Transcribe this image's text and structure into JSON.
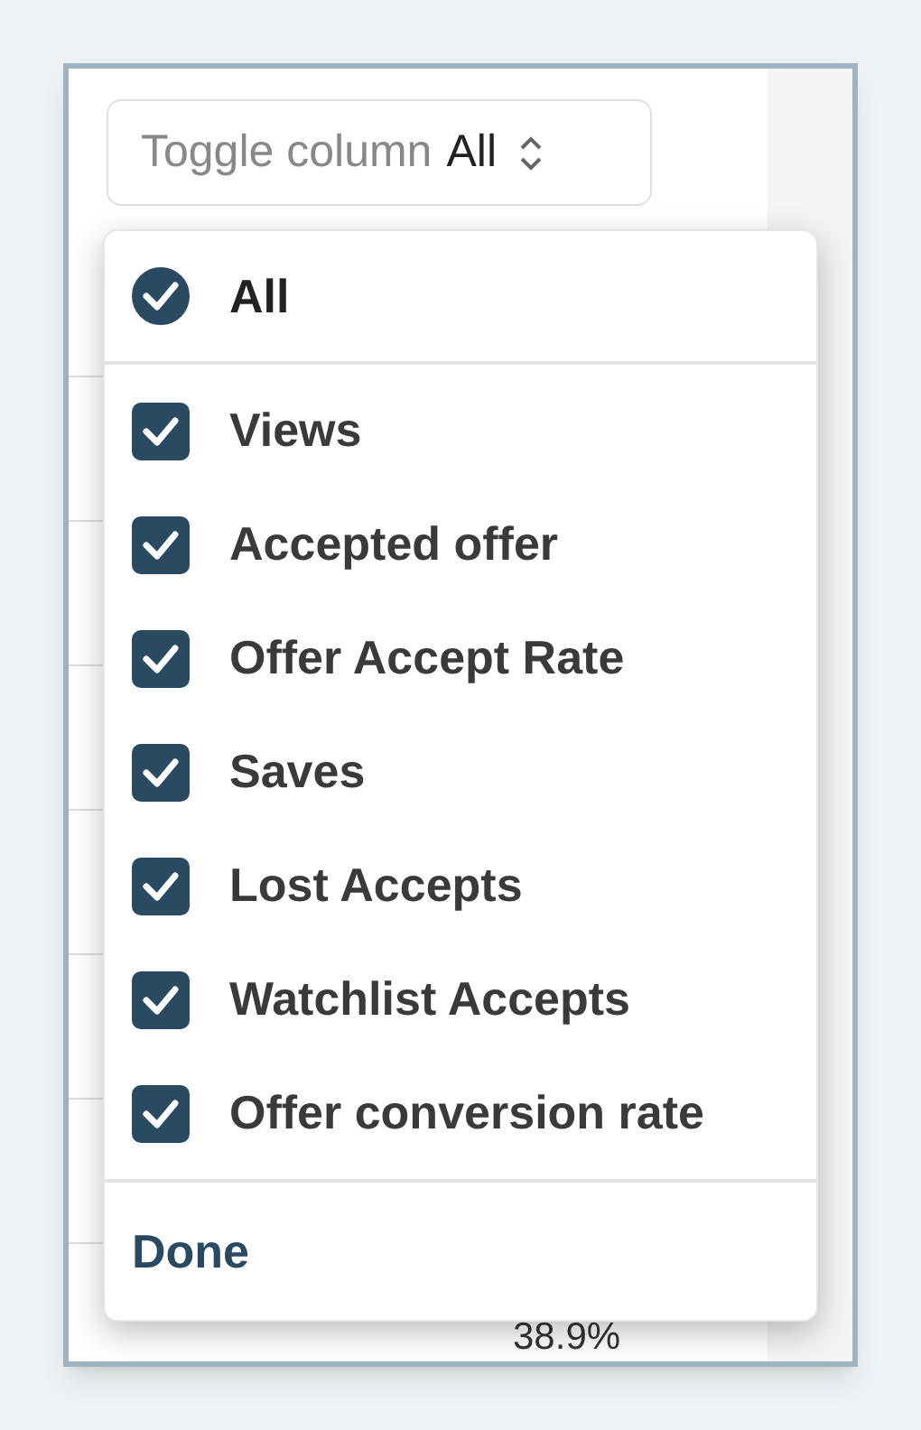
{
  "toggle": {
    "label": "Toggle column",
    "value": "All"
  },
  "menu": {
    "all": {
      "label": "All",
      "checked": true
    },
    "items": [
      {
        "label": "Views",
        "checked": true
      },
      {
        "label": "Accepted offer",
        "checked": true
      },
      {
        "label": "Offer Accept Rate",
        "checked": true
      },
      {
        "label": "Saves",
        "checked": true
      },
      {
        "label": "Lost Accepts",
        "checked": true
      },
      {
        "label": "Watchlist Accepts",
        "checked": true
      },
      {
        "label": "Offer conversion rate",
        "checked": true
      }
    ],
    "done": "Done"
  },
  "table": {
    "last_value": "38.9%"
  }
}
